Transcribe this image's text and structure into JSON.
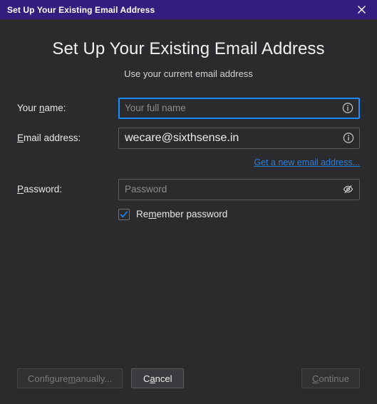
{
  "titlebar": {
    "title": "Set Up Your Existing Email Address",
    "close_icon": "close-icon",
    "background_color": "#331E7F"
  },
  "header": {
    "title": "Set Up Your Existing Email Address",
    "subtitle": "Use your current email address"
  },
  "form": {
    "name_field": {
      "label_pre": "Your ",
      "label_key": "n",
      "label_post": "ame:",
      "label_full": "Your name:",
      "value": "",
      "placeholder": "Your full name",
      "focused": true,
      "icon": "info-icon"
    },
    "email_field": {
      "label_pre": "",
      "label_key": "E",
      "label_post": "mail address:",
      "label_full": "Email address:",
      "value": "wecare@sixthsense.in",
      "placeholder": "",
      "focused": false,
      "icon": "info-icon"
    },
    "new_email_link": "Get a new email address...",
    "password_field": {
      "label_pre": "",
      "label_key": "P",
      "label_post": "assword:",
      "label_full": "Password:",
      "value": "",
      "placeholder": "Password",
      "focused": false,
      "icon": "eye-hidden-icon"
    },
    "remember_checkbox": {
      "label_pre": "Re",
      "label_key": "m",
      "label_post": "ember password",
      "label_full": "Remember password",
      "checked": true
    }
  },
  "footer": {
    "configure_manually": {
      "label_pre": "Configure ",
      "label_key": "m",
      "label_post": "anually...",
      "label_full": "Configure manually...",
      "enabled": false
    },
    "cancel": {
      "label_pre": "C",
      "label_key": "a",
      "label_post": "ncel",
      "label_full": "Cancel",
      "enabled": true
    },
    "continue": {
      "label_pre": "",
      "label_key": "C",
      "label_post": "ontinue",
      "label_full": "Continue",
      "enabled": false
    }
  },
  "colors": {
    "titlebar": "#331E7F",
    "background": "#2B2B2E",
    "focus_border": "#1A8CFF",
    "link": "#2A7FDD",
    "check_accent": "#1A8CFF"
  }
}
